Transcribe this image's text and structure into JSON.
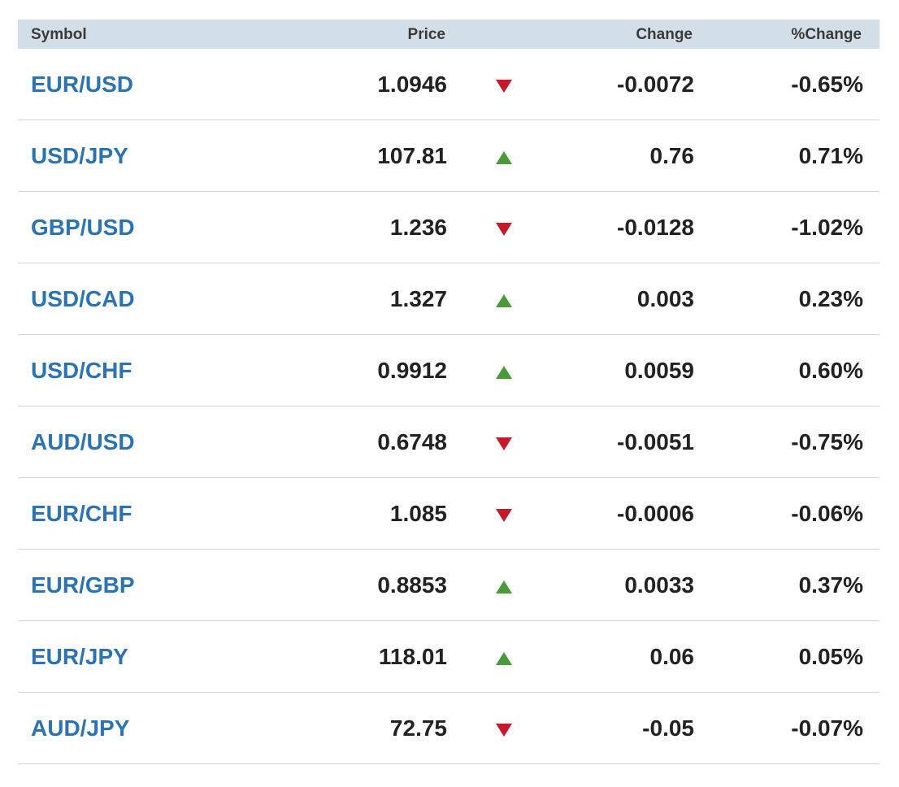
{
  "colors": {
    "header_bg": "#d3dfe8",
    "symbol_link": "#2b73b1",
    "up": "#4a9a3c",
    "down": "#c8182c",
    "divider": "#cfd8df"
  },
  "table": {
    "headers": {
      "symbol": "Symbol",
      "price": "Price",
      "change": "Change",
      "pct_change": "%Change"
    },
    "rows": [
      {
        "symbol": "EUR/USD",
        "price": "1.0946",
        "direction": "down",
        "change": "-0.0072",
        "pct_change": "-0.65%"
      },
      {
        "symbol": "USD/JPY",
        "price": "107.81",
        "direction": "up",
        "change": "0.76",
        "pct_change": "0.71%"
      },
      {
        "symbol": "GBP/USD",
        "price": "1.236",
        "direction": "down",
        "change": "-0.0128",
        "pct_change": "-1.02%"
      },
      {
        "symbol": "USD/CAD",
        "price": "1.327",
        "direction": "up",
        "change": "0.003",
        "pct_change": "0.23%"
      },
      {
        "symbol": "USD/CHF",
        "price": "0.9912",
        "direction": "up",
        "change": "0.0059",
        "pct_change": "0.60%"
      },
      {
        "symbol": "AUD/USD",
        "price": "0.6748",
        "direction": "down",
        "change": "-0.0051",
        "pct_change": "-0.75%"
      },
      {
        "symbol": "EUR/CHF",
        "price": "1.085",
        "direction": "down",
        "change": "-0.0006",
        "pct_change": "-0.06%"
      },
      {
        "symbol": "EUR/GBP",
        "price": "0.8853",
        "direction": "up",
        "change": "0.0033",
        "pct_change": "0.37%"
      },
      {
        "symbol": "EUR/JPY",
        "price": "118.01",
        "direction": "up",
        "change": "0.06",
        "pct_change": "0.05%"
      },
      {
        "symbol": "AUD/JPY",
        "price": "72.75",
        "direction": "down",
        "change": "-0.05",
        "pct_change": "-0.07%"
      }
    ]
  }
}
